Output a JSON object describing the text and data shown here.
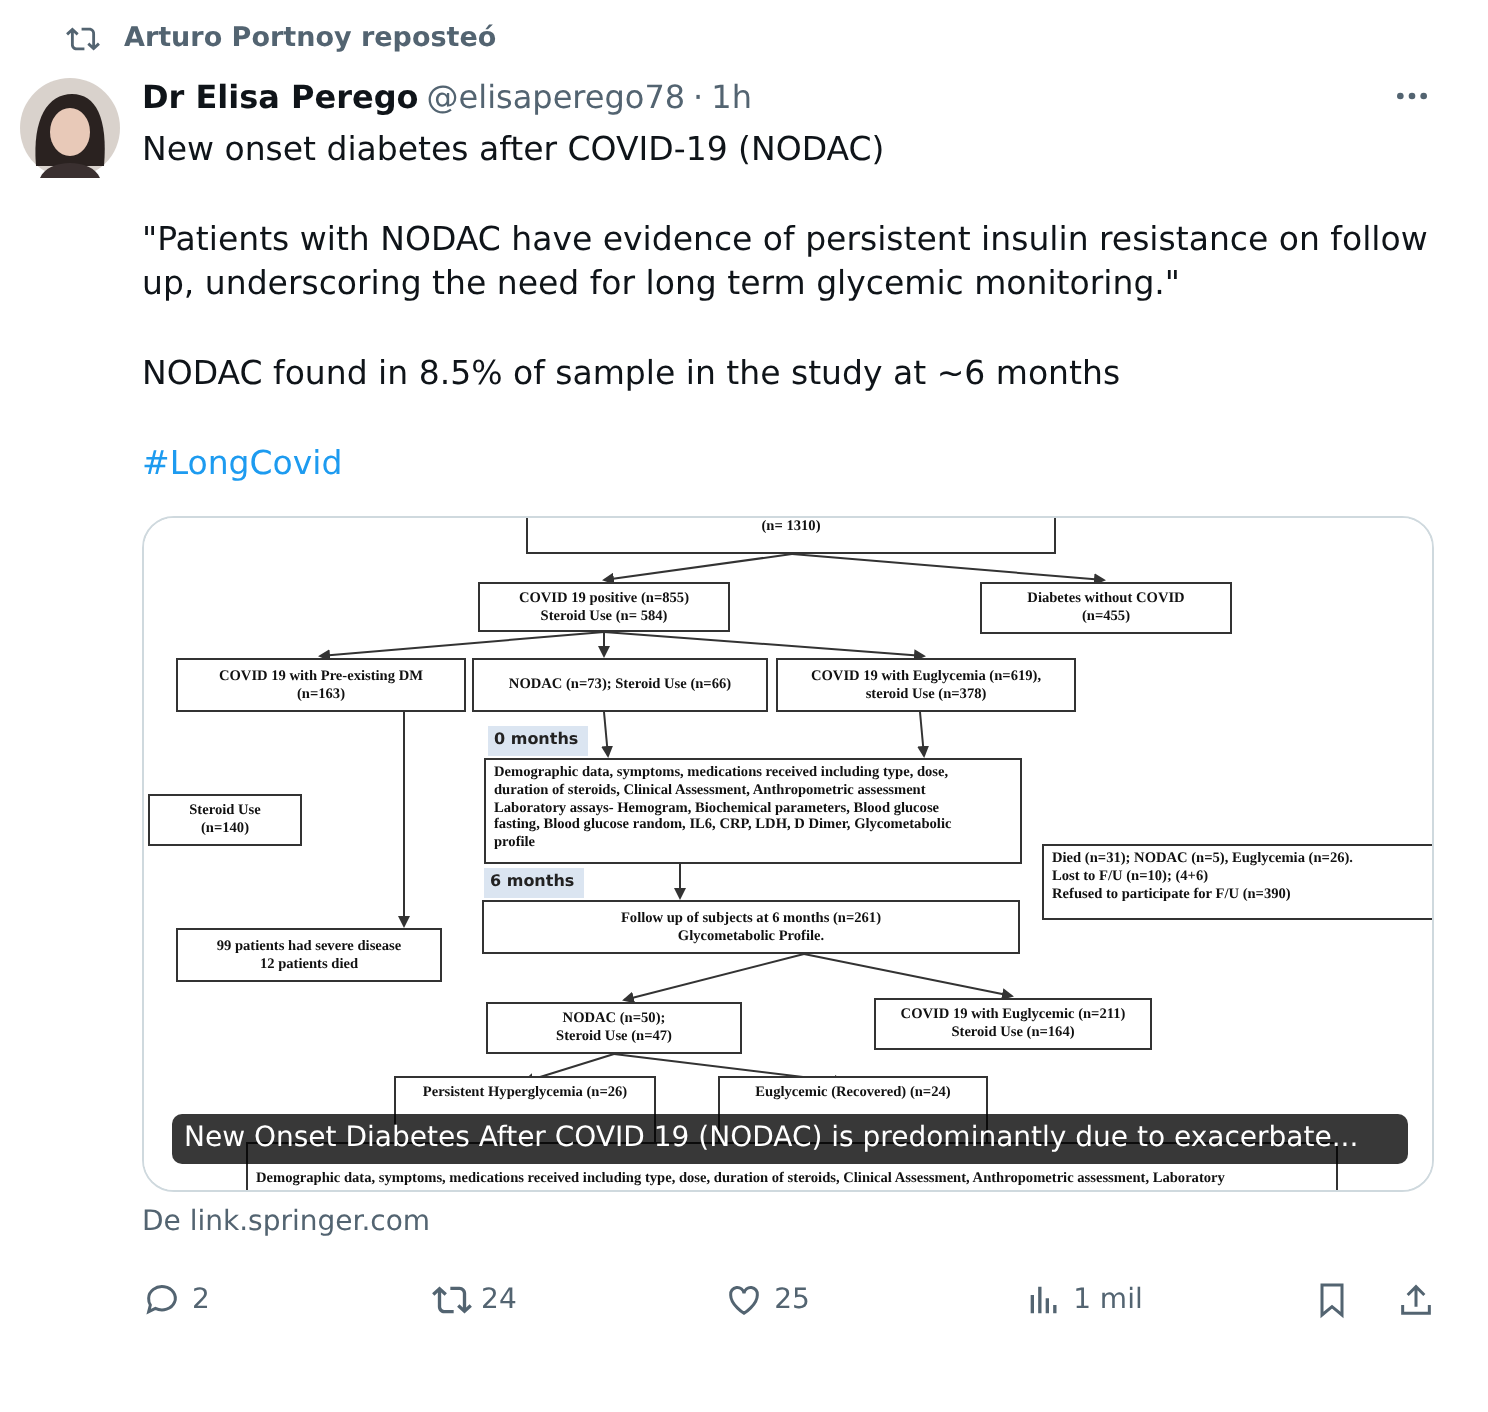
{
  "repost": {
    "label": "Arturo Portnoy reposteó"
  },
  "post": {
    "author": "Dr Elisa Perego",
    "handle": "@elisaperego78",
    "dot": "·",
    "time": "1h",
    "paragraphs": [
      {
        "kind": "text",
        "text": "New onset diabetes after COVID-19 (NODAC)"
      },
      {
        "kind": "text",
        "text": "\"Patients with NODAC have evidence of persistent insulin resistance on follow up, underscoring the need for long term glycemic monitoring.\""
      },
      {
        "kind": "text",
        "text": "NODAC found in 8.5% of sample in the study at ~6 months"
      },
      {
        "kind": "hashtag",
        "text": "#LongCovid"
      }
    ]
  },
  "card": {
    "caption": "New Onset Diabetes After COVID 19 (NODAC) is predominantly due to exacerbate...",
    "source": "De link.springer.com",
    "flowchart": [
      {
        "kind": "box",
        "lines": [
          "(n= 1310)"
        ]
      },
      {
        "kind": "box",
        "lines": [
          "COVID 19 positive (n=855)",
          "Steroid Use (n= 584)"
        ]
      },
      {
        "kind": "box",
        "lines": [
          "Diabetes without COVID",
          "(n=455)"
        ]
      },
      {
        "kind": "box",
        "lines": [
          "COVID 19 with Pre-existing DM",
          "(n=163)"
        ]
      },
      {
        "kind": "box",
        "lines": [
          "NODAC  (n=73); Steroid Use (n=66)"
        ]
      },
      {
        "kind": "box",
        "lines": [
          "COVID 19 with Euglycemia (n=619),",
          "steroid Use (n=378)"
        ]
      },
      {
        "kind": "label",
        "lines": [
          "0 months"
        ]
      },
      {
        "kind": "box",
        "lines": [
          "Demographic data, symptoms, medications received including type, dose,",
          "duration of steroids, Clinical Assessment, Anthropometric assessment",
          "Laboratory assays- Hemogram, Biochemical parameters, Blood glucose",
          "fasting, Blood glucose random, IL6, CRP, LDH, D Dimer, Glycometabolic",
          "profile"
        ]
      },
      {
        "kind": "box",
        "lines": [
          "Steroid Use",
          "(n=140)"
        ]
      },
      {
        "kind": "label",
        "lines": [
          "6 months"
        ]
      },
      {
        "kind": "box",
        "lines": [
          "Follow up of subjects at 6 months (n=261)",
          "Glycometabolic Profile."
        ]
      },
      {
        "kind": "box",
        "lines": [
          "Died (n=31); NODAC (n=5), Euglycemia (n=26).",
          "Lost to F/U (n=10); (4+6)",
          "Refused to participate for F/U (n=390)"
        ]
      },
      {
        "kind": "box",
        "lines": [
          "99 patients had severe disease",
          "12 patients died"
        ]
      },
      {
        "kind": "box",
        "lines": [
          "NODAC (n=50);",
          "Steroid Use (n=47)"
        ]
      },
      {
        "kind": "box",
        "lines": [
          "COVID 19 with Euglycemic (n=211)",
          "Steroid Use (n=164)"
        ]
      },
      {
        "kind": "box",
        "lines": [
          "Persistent Hyperglycemia (n=26)"
        ]
      },
      {
        "kind": "box",
        "lines": [
          "Euglycemic (Recovered) (n=24)"
        ]
      },
      {
        "kind": "box",
        "lines": [
          "Demographic data, symptoms, medications received including type, dose, duration of steroids, Clinical Assessment, Anthropometric assessment, Laboratory"
        ]
      }
    ]
  },
  "actions": [
    {
      "kind": "reply",
      "count": "2"
    },
    {
      "kind": "repost",
      "count": "24"
    },
    {
      "kind": "like",
      "count": "25"
    },
    {
      "kind": "views",
      "count": "1 mil"
    },
    {
      "kind": "bookmark"
    },
    {
      "kind": "share"
    }
  ]
}
